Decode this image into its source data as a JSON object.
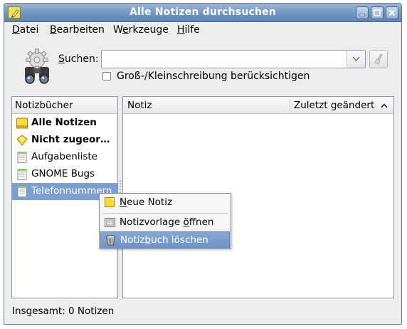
{
  "window": {
    "title": "Alle Notizen durchsuchen"
  },
  "menubar": [
    {
      "pre": "",
      "mnemonic": "D",
      "post": "atei"
    },
    {
      "pre": "",
      "mnemonic": "B",
      "post": "earbeiten"
    },
    {
      "pre": "W",
      "mnemonic": "e",
      "post": "rkzeuge"
    },
    {
      "pre": "",
      "mnemonic": "H",
      "post": "ilfe"
    }
  ],
  "search": {
    "label_mnemonic": "S",
    "label_rest": "uchen:",
    "value": "",
    "case_sensitive_label": "Groß-/Kleinschreibung berücksichtigen",
    "case_sensitive_checked": false
  },
  "notebooks": {
    "header": "Notizbücher",
    "items": [
      {
        "label": "Alle Notizen",
        "bold": true,
        "icon": "all-notes-icon"
      },
      {
        "label": "Nicht zugeor…",
        "bold": true,
        "icon": "unfiled-notes-icon"
      },
      {
        "label": "Aufgabenliste",
        "bold": false,
        "icon": "notebook-icon"
      },
      {
        "label": "GNOME Bugs",
        "bold": false,
        "icon": "notebook-icon"
      },
      {
        "label": "Telefonnummern",
        "bold": false,
        "icon": "notebook-icon",
        "selected": true
      }
    ]
  },
  "notes": {
    "col_note": "Notiz",
    "col_modified": "Zuletzt geändert",
    "sort_indicator": "ascending",
    "rows": []
  },
  "context_menu": {
    "items": [
      {
        "pre": "",
        "mnemonic": "N",
        "post": "eue Notiz",
        "icon": "new-note-icon"
      },
      {
        "pre": "Notizvorlage ",
        "mnemonic": "ö",
        "post": "ffnen",
        "icon": "template-icon"
      },
      {
        "pre": "Notiz",
        "mnemonic": "b",
        "post": "uch löschen",
        "icon": "trash-icon",
        "highlighted": true
      }
    ]
  },
  "status": {
    "text": "Insgesamt: 0 Notizen"
  },
  "colors": {
    "selection": "#7b9fd0",
    "titlebar": "#7497c3",
    "menu_highlight": "#7b9fd0"
  }
}
